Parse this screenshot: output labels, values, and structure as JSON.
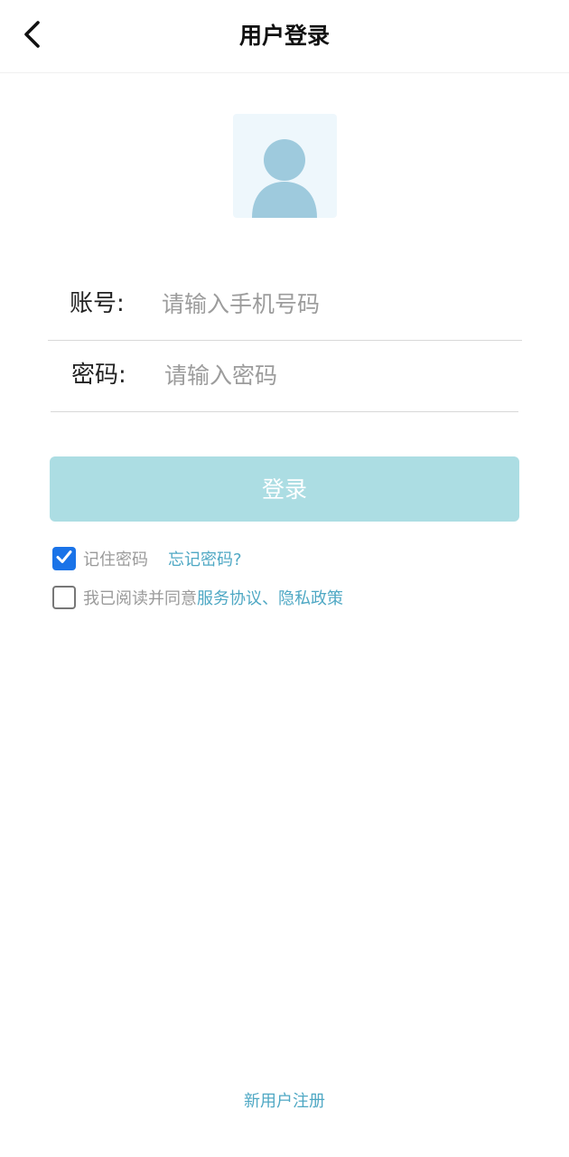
{
  "header": {
    "title": "用户登录",
    "back_icon": "chevron-left-icon"
  },
  "avatar": {
    "icon": "user-avatar-icon",
    "bg_color": "#eef7fc",
    "icon_color": "#9ecadd"
  },
  "form": {
    "account_label": "账号:",
    "account_placeholder": "请输入手机号码",
    "account_value": "",
    "password_label": "密码:",
    "password_placeholder": "请输入密码",
    "password_value": ""
  },
  "login_button": {
    "label": "登录",
    "bg_color": "#acdde3"
  },
  "remember": {
    "checked": true,
    "label": "记住密码",
    "forgot_label": "忘记密码?"
  },
  "agreement": {
    "checked": false,
    "prefix": "我已阅读并同意",
    "service_label": "服务协议",
    "separator": "、",
    "privacy_label": "隐私政策"
  },
  "footer": {
    "register_label": "新用户注册"
  },
  "colors": {
    "accent_link": "#4fa8c4",
    "checkbox_checked": "#1a73e8"
  }
}
